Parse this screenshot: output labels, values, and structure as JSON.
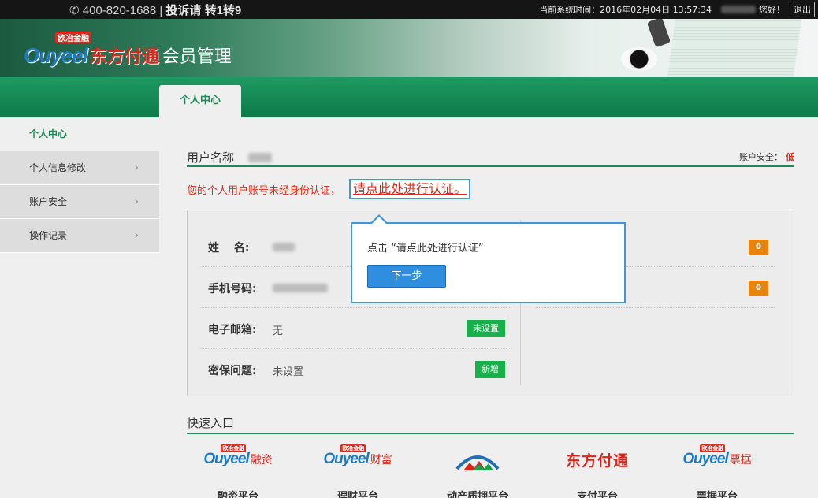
{
  "topbar": {
    "phone": "400-820-1688",
    "complaint": "投诉请 转1转9",
    "time_label": "当前系统时间：",
    "time_value": "2016年02月04日 13:57:34",
    "greeting": "您好！",
    "logout": "退出"
  },
  "brand": {
    "badge": "欧冶金融",
    "ouyeel": "Ouyeel",
    "name": "东方付通",
    "system": "会员管理"
  },
  "nav": {
    "active_tab": "个人中心"
  },
  "sidebar": {
    "items": [
      {
        "label": "个人中心",
        "active": true
      },
      {
        "label": "个人信息修改"
      },
      {
        "label": "账户安全"
      },
      {
        "label": "操作记录"
      }
    ]
  },
  "profile": {
    "username_label": "用户名称",
    "security_label": "账户安全：",
    "security_level": "低",
    "warning_text": "您的个人用户账号未经身份认证，",
    "verify_link": "请点此处进行认证。",
    "rows": [
      {
        "label": "姓　 名:",
        "value": ""
      },
      {
        "label": "手机号码:",
        "value": ""
      },
      {
        "label": "电子邮箱:",
        "value": "无",
        "action": "未设置"
      },
      {
        "label": "密保问题:",
        "value": "未设置",
        "action": "新增"
      }
    ],
    "right_badges": [
      "0",
      "0"
    ]
  },
  "guide_popup": {
    "message": "点击 “请点此处进行认证”",
    "next_button": "下一步"
  },
  "quick_entry": {
    "title": "快速入口",
    "items": [
      {
        "suffix": "融资",
        "name": "融资平台"
      },
      {
        "suffix": "财富",
        "name": "理财平台"
      },
      {
        "name": "动产质押平台"
      },
      {
        "logo": "东方付通",
        "name": "支付平台"
      },
      {
        "suffix": "票据",
        "name": "票据平台"
      }
    ]
  }
}
